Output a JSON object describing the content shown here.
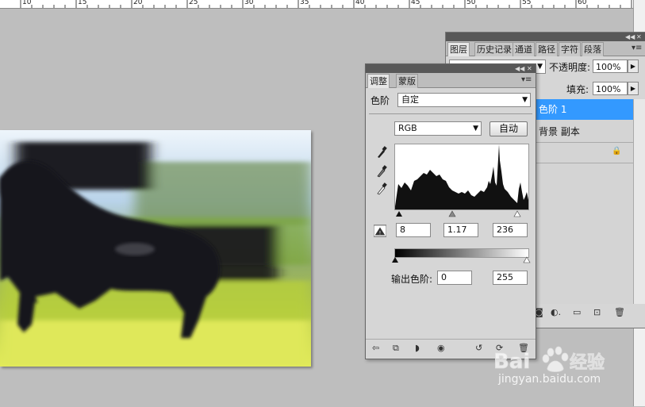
{
  "ruler": {
    "labels": [
      "10",
      "15",
      "20",
      "25",
      "30",
      "35",
      "40",
      "45",
      "50",
      "55",
      "60"
    ]
  },
  "adjustments": {
    "tabs": [
      {
        "label": "调整"
      },
      {
        "label": "蒙版"
      }
    ],
    "preset_label": "色阶",
    "preset_value": "自定",
    "channel_value": "RGB",
    "auto_label": "自动",
    "input_black": "8",
    "input_gamma": "1.17",
    "input_white": "236",
    "output_label": "输出色阶:",
    "output_black": "0",
    "output_white": "255"
  },
  "layers": {
    "tabs": [
      {
        "label": "图层"
      },
      {
        "label": "历史记录"
      },
      {
        "label": "通道"
      },
      {
        "label": "路径"
      },
      {
        "label": "字符"
      },
      {
        "label": "段落"
      }
    ],
    "opacity_label": "不透明度:",
    "opacity_value": "100%",
    "fill_label": "填充:",
    "fill_value": "100%",
    "items": [
      {
        "name": "色阶 1",
        "selected": true
      },
      {
        "name": "背景 副本",
        "selected": false
      }
    ]
  },
  "watermark": {
    "text": "Bai du 经验",
    "url": "jingyan.baidu.com"
  },
  "colors": {
    "selection": "#3399ff",
    "panel": "#d6d6d6",
    "workspace": "#bebebe"
  }
}
